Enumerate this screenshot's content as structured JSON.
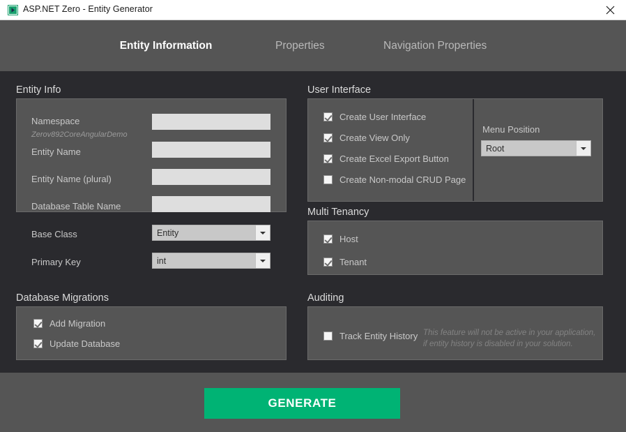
{
  "window": {
    "title": "ASP.NET Zero - Entity Generator",
    "app_icon": "aspnet-zero-icon",
    "close_icon": "close-icon"
  },
  "tabs": [
    {
      "label": "Entity Information",
      "active": true
    },
    {
      "label": "Properties",
      "active": false
    },
    {
      "label": "Navigation Properties",
      "active": false
    }
  ],
  "entity_info": {
    "title": "Entity Info",
    "fields": {
      "namespace_label": "Namespace",
      "namespace_sub": "Zerov892CoreAngularDemo",
      "namespace_value": "",
      "entity_name_label": "Entity Name",
      "entity_name_value": "",
      "entity_name_plural_label": "Entity Name (plural)",
      "entity_name_plural_value": "",
      "database_table_name_label": "Database Table Name",
      "database_table_name_value": "",
      "base_class_label": "Base Class",
      "base_class_value": "Entity",
      "primary_key_label": "Primary Key",
      "primary_key_value": "int"
    }
  },
  "database_migrations": {
    "title": "Database Migrations",
    "items": [
      {
        "label": "Add Migration",
        "checked": true
      },
      {
        "label": "Update Database",
        "checked": true
      }
    ]
  },
  "user_interface": {
    "title": "User Interface",
    "items": [
      {
        "label": "Create User Interface",
        "checked": true
      },
      {
        "label": "Create View Only",
        "checked": true
      },
      {
        "label": "Create Excel Export Button",
        "checked": true
      },
      {
        "label": "Create Non-modal CRUD Page",
        "checked": false
      }
    ],
    "menu_position_label": "Menu Position",
    "menu_position_value": "Root"
  },
  "multi_tenancy": {
    "title": "Multi Tenancy",
    "items": [
      {
        "label": "Host",
        "checked": true
      },
      {
        "label": "Tenant",
        "checked": true
      }
    ]
  },
  "auditing": {
    "title": "Auditing",
    "items": [
      {
        "label": "Track Entity History",
        "checked": false
      }
    ],
    "hint": "This feature will not be active in your application,\nif entity history is disabled in your solution."
  },
  "footer": {
    "generate_label": "GENERATE"
  },
  "colors": {
    "accent_green": "#00b374",
    "panel": "#555555",
    "background": "#2a2a2e",
    "input": "#dedede"
  }
}
